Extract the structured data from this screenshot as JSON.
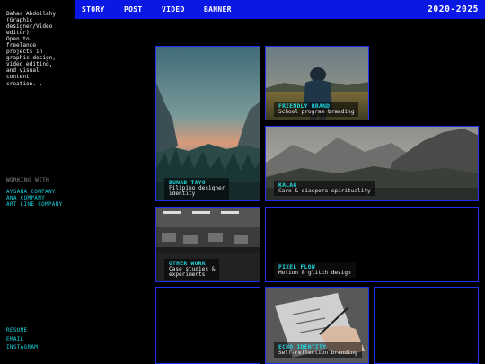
{
  "nav": {
    "items": [
      {
        "label": "STORY"
      },
      {
        "label": "POST"
      },
      {
        "label": "VIDEO"
      },
      {
        "label": "BANNER"
      }
    ],
    "year_range": "2020-2025"
  },
  "sidebar": {
    "bio": "Bahar Abdollahy\n(Graphic\ndesigner/Video\neditor)\nOpen to\nfreelance\nprojects in\ngraphic design,\nvideo editing,\nand visual\ncontent\ncreation. .",
    "working_with_heading": "WORKING WITH",
    "clients": [
      {
        "label": "AYSANA COMPANY"
      },
      {
        "label": "ANA COMPANY"
      },
      {
        "label": "ART LINE COMPANY"
      }
    ],
    "links": [
      {
        "label": "RESUME"
      },
      {
        "label": "EMAIL"
      },
      {
        "label": "INSTAGRAM"
      }
    ]
  },
  "cards": [
    {
      "title": "FRIENDLY BRAND",
      "subtitle": "School program branding"
    },
    {
      "title": "DUNAD TAYO",
      "subtitle": "Filipino designer\nidentity"
    },
    {
      "title": "KALAG",
      "subtitle": "Care & diaspora spirituality"
    },
    {
      "title": "OTHER WORK",
      "subtitle": "Case studies &\nexperiments"
    },
    {
      "title": "PIXEL FLOW",
      "subtitle": "Motion & glitch design"
    },
    {
      "title": "ECHO IDENTITY",
      "subtitle": "Self-reflection branding"
    }
  ],
  "colors": {
    "nav_bar": "#0a18e6",
    "card_border": "#1f2ff0",
    "accent_cyan": "#19d3dc",
    "background": "#000000"
  }
}
